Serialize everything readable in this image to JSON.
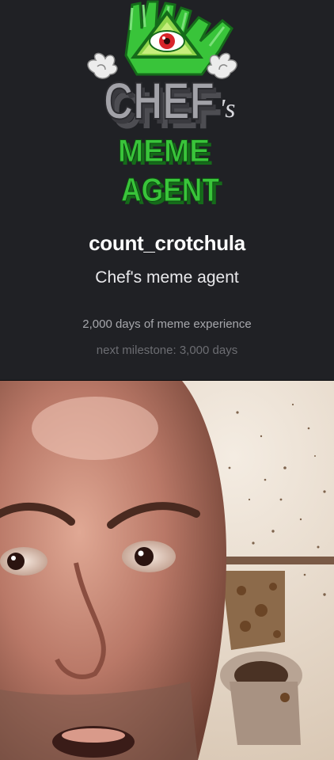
{
  "profile": {
    "username": "count_crotchula",
    "tagline": "Chef's meme agent",
    "experience": "2,000 days of meme experience",
    "milestone": "next milestone: 3,000 days"
  },
  "logo": {
    "word_chef": "CHEF",
    "word_s": "'s",
    "word_meme": "MEME",
    "word_agent": "AGENT",
    "colors": {
      "green": "#39c43a",
      "dark_green": "#156b1a",
      "gray": "#9a9aa0",
      "dark_gray": "#4d4d52",
      "eye_red": "#d8242a"
    }
  },
  "post": {
    "image_label": "meme-photo"
  },
  "colors": {
    "background": "#202125",
    "username": "#ffffff",
    "tagline": "#e9e9ec",
    "experience": "#a6a7ac",
    "milestone": "#6c6d72"
  }
}
